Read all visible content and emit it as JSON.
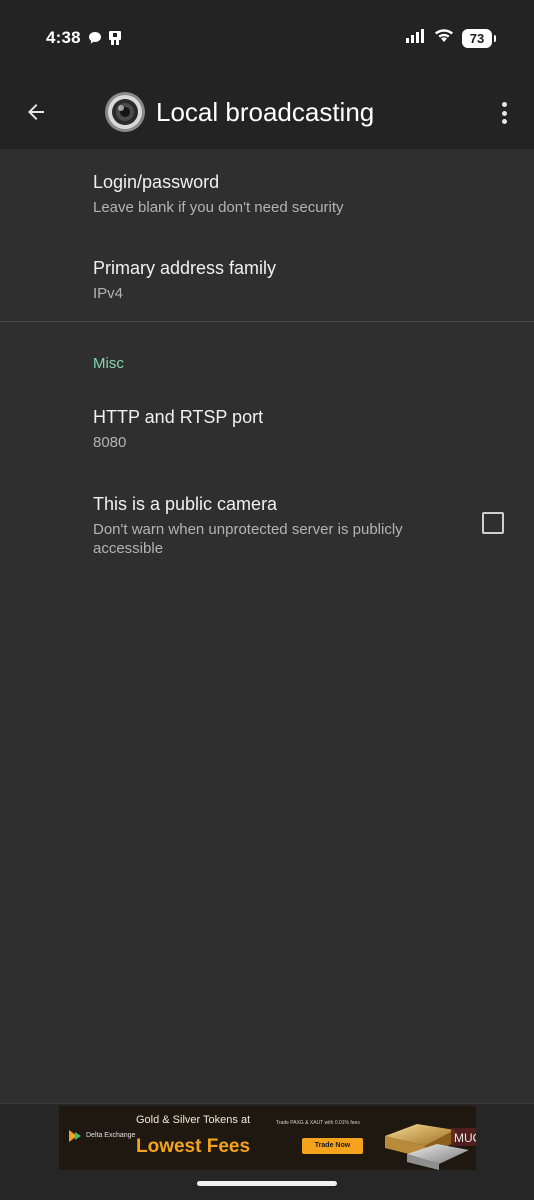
{
  "status_bar": {
    "time": "4:38",
    "battery": "73",
    "icons": [
      "chat-notification-icon",
      "app-notification-icon",
      "signal-icon",
      "wifi-icon",
      "battery-icon"
    ]
  },
  "app_bar": {
    "title": "Local broadcasting",
    "icons": [
      "back-arrow-icon",
      "camera-lens-logo-icon",
      "more-vertical-icon"
    ]
  },
  "preferences": [
    {
      "title": "Login/password",
      "summary": "Leave blank if you don't need security"
    },
    {
      "title": "Primary address family",
      "summary": "IPv4"
    }
  ],
  "misc": {
    "category": "Misc",
    "items": [
      {
        "title": "HTTP and RTSP port",
        "summary": "8080"
      },
      {
        "title": "This is a public camera",
        "summary": "Don't warn when unprotected server is publicly accessible",
        "checked": false
      }
    ]
  },
  "ad": {
    "brand": "Delta Exchange",
    "headline": "Gold & Silver Tokens at",
    "cta_text": "Lowest Fees",
    "small_text": "Trade PAXG & XAUT with 0.01% fees",
    "button_label": "Trade Now",
    "watermark": "MUO"
  },
  "colors": {
    "accent": "#86d3b4",
    "background": "#2f2f2f",
    "bar": "#232323",
    "ad_orange": "#f5a21c"
  }
}
